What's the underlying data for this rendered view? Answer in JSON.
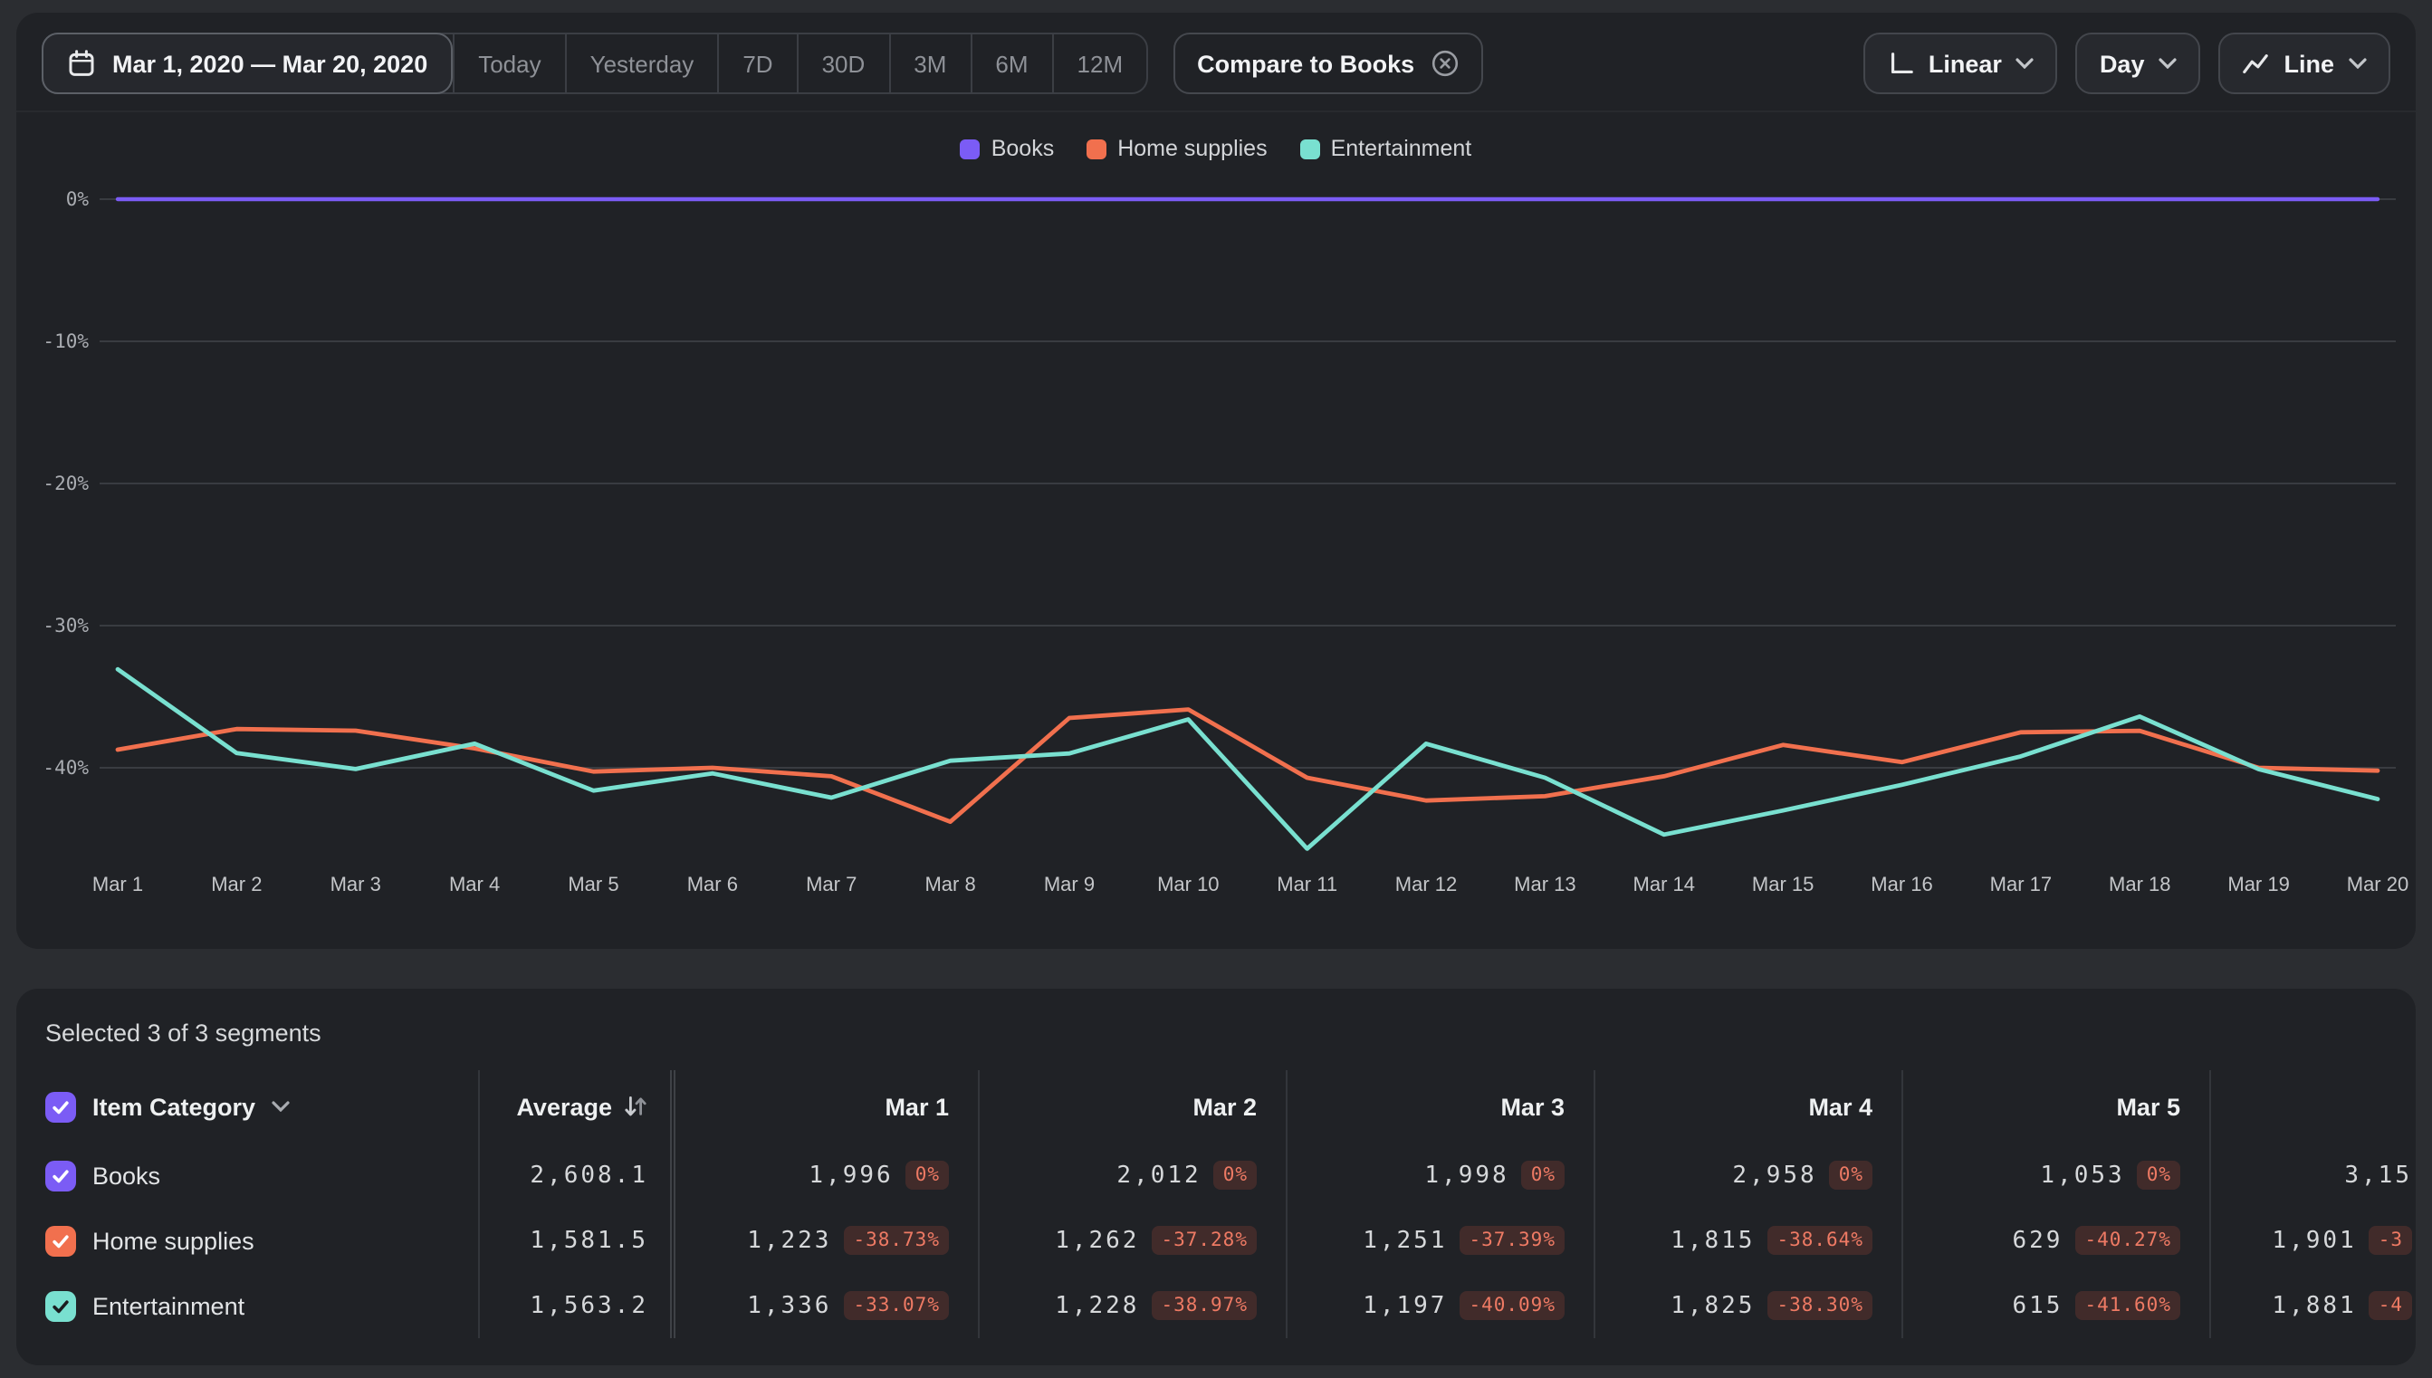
{
  "colors": {
    "page_bg": "#2b2d31",
    "panel_bg": "#202226",
    "books": "#7b5cf5",
    "home_supplies": "#f1704e",
    "entertainment": "#79e0d0",
    "badge_bg": "rgba(244,92,70,0.16)",
    "badge_fg": "#ee7a64"
  },
  "toolbar": {
    "date_range": "Mar 1, 2020 — Mar 20, 2020",
    "quick_ranges": [
      "Today",
      "Yesterday",
      "7D",
      "30D",
      "3M",
      "6M",
      "12M"
    ],
    "compare_label": "Compare to Books",
    "scale_label": "Linear",
    "granularity_label": "Day",
    "chart_type_label": "Line"
  },
  "legend": [
    {
      "label": "Books",
      "color": "#7b5cf5"
    },
    {
      "label": "Home supplies",
      "color": "#f1704e"
    },
    {
      "label": "Entertainment",
      "color": "#79e0d0"
    }
  ],
  "chart_data": {
    "type": "line",
    "title": "",
    "x": [
      "Mar 1",
      "Mar 2",
      "Mar 3",
      "Mar 4",
      "Mar 5",
      "Mar 6",
      "Mar 7",
      "Mar 8",
      "Mar 9",
      "Mar 10",
      "Mar 11",
      "Mar 12",
      "Mar 13",
      "Mar 14",
      "Mar 15",
      "Mar 16",
      "Mar 17",
      "Mar 18",
      "Mar 19",
      "Mar 20"
    ],
    "y_ticks": [
      {
        "label": "0%",
        "value": 0
      },
      {
        "label": "-10%",
        "value": -10
      },
      {
        "label": "-20%",
        "value": -20
      },
      {
        "label": "-30%",
        "value": -30
      },
      {
        "label": "-40%",
        "value": -40
      }
    ],
    "ylim": [
      -47,
      1
    ],
    "grid": true,
    "legend_position": "top-center",
    "series": [
      {
        "name": "Books",
        "color": "#7b5cf5",
        "values": [
          0,
          0,
          0,
          0,
          0,
          0,
          0,
          0,
          0,
          0,
          0,
          0,
          0,
          0,
          0,
          0,
          0,
          0,
          0,
          0
        ]
      },
      {
        "name": "Home supplies",
        "color": "#f1704e",
        "values": [
          -38.73,
          -37.28,
          -37.39,
          -38.64,
          -40.27,
          -40.0,
          -40.6,
          -43.8,
          -36.5,
          -35.9,
          -40.7,
          -42.3,
          -42.0,
          -40.6,
          -38.4,
          -39.6,
          -37.5,
          -37.4,
          -40.0,
          -40.2
        ]
      },
      {
        "name": "Entertainment",
        "color": "#79e0d0",
        "values": [
          -33.07,
          -38.97,
          -40.09,
          -38.3,
          -41.6,
          -40.4,
          -42.1,
          -39.5,
          -39.0,
          -36.6,
          -45.7,
          -38.3,
          -40.7,
          -44.7,
          -43.0,
          -41.2,
          -39.2,
          -36.4,
          -40.1,
          -42.2
        ]
      }
    ]
  },
  "table": {
    "selected_text": "Selected 3 of 3 segments",
    "category_header": "Item Category",
    "average_header": "Average",
    "columns": [
      "Mar 1",
      "Mar 2",
      "Mar 3",
      "Mar 4",
      "Mar 5"
    ],
    "rows": [
      {
        "label": "Books",
        "checkbox_color": "#7b5cf5",
        "average": "2,608.1",
        "cells": [
          [
            "1,996",
            "0%"
          ],
          [
            "2,012",
            "0%"
          ],
          [
            "1,998",
            "0%"
          ],
          [
            "2,958",
            "0%"
          ],
          [
            "1,053",
            "0%"
          ]
        ],
        "cutoff": [
          "3,15",
          ""
        ]
      },
      {
        "label": "Home supplies",
        "checkbox_color": "#f1704e",
        "average": "1,581.5",
        "cells": [
          [
            "1,223",
            "-38.73%"
          ],
          [
            "1,262",
            "-37.28%"
          ],
          [
            "1,251",
            "-37.39%"
          ],
          [
            "1,815",
            "-38.64%"
          ],
          [
            "629",
            "-40.27%"
          ]
        ],
        "cutoff": [
          "1,901",
          "-3"
        ]
      },
      {
        "label": "Entertainment",
        "checkbox_color": "#79e0d0",
        "average": "1,563.2",
        "cells": [
          [
            "1,336",
            "-33.07%"
          ],
          [
            "1,228",
            "-38.97%"
          ],
          [
            "1,197",
            "-40.09%"
          ],
          [
            "1,825",
            "-38.30%"
          ],
          [
            "615",
            "-41.60%"
          ]
        ],
        "cutoff": [
          "1,881",
          "-4"
        ]
      }
    ]
  }
}
